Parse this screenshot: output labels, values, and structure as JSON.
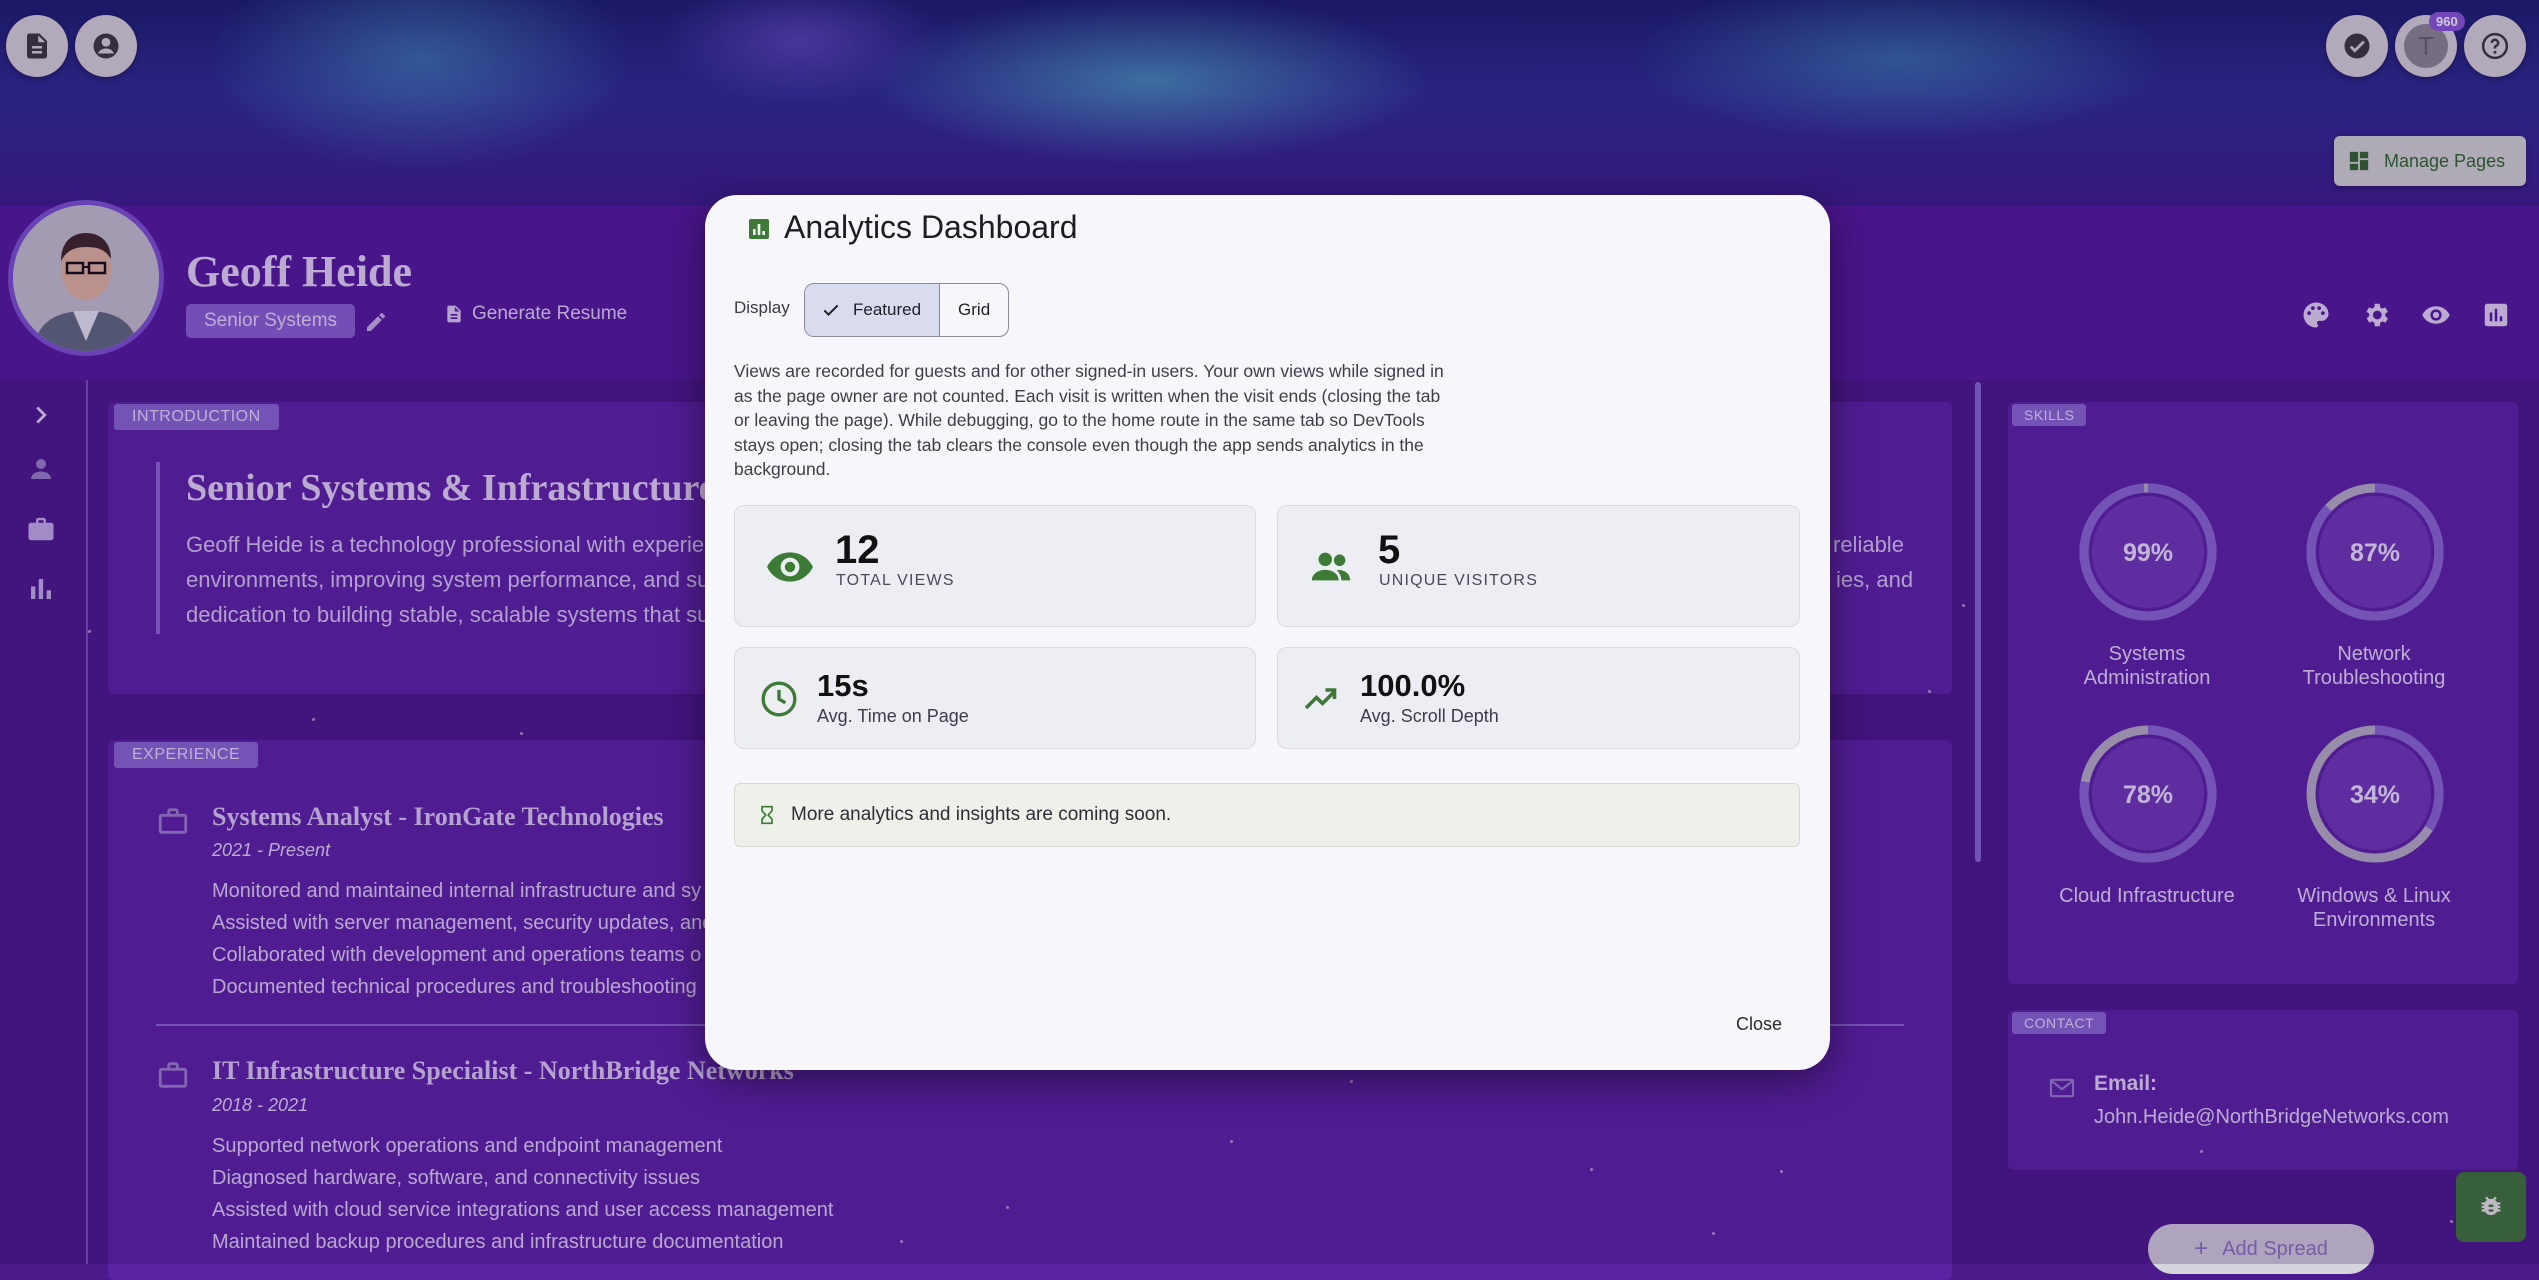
{
  "app": {
    "profile_name": "Geoff Heide",
    "role_chip": "Senior Systems",
    "generate_resume": "Generate Resume",
    "manage_pages": "Manage Pages",
    "notification_count": "960",
    "avatar_letter": "T"
  },
  "intro": {
    "tag": "INTRODUCTION",
    "title": "Senior Systems & Infrastructure",
    "line1": "Geoff Heide is a technology professional with experienc",
    "line2": "environments, improving system performance, and supp",
    "line3": "dedication to building stable, scalable systems that supp",
    "right1": "reliable",
    "right2": "ies, and"
  },
  "experience": {
    "tag": "EXPERIENCE",
    "jobs": [
      {
        "title": "Systems Analyst - IronGate Technologies",
        "date": "2021 - Present",
        "lines": [
          "Monitored and maintained internal infrastructure and sy",
          "Assisted with server management, security updates, and",
          "Collaborated with development and operations teams o",
          "Documented technical procedures and troubleshooting"
        ]
      },
      {
        "title": "IT Infrastructure Specialist - NorthBridge Networks",
        "date": "2018 - 2021",
        "lines": [
          "Supported network operations and endpoint management",
          "Diagnosed hardware, software, and connectivity issues",
          "Assisted with cloud service integrations and user access management",
          "Maintained backup procedures and infrastructure documentation"
        ]
      }
    ]
  },
  "skills": {
    "tag": "SKILLS",
    "items": [
      {
        "label_1": "Systems",
        "label_2": "Administration",
        "value_text": "99%",
        "value": 0.99
      },
      {
        "label_1": "Network",
        "label_2": "Troubleshooting",
        "value_text": "87%",
        "value": 0.87
      },
      {
        "label_1": "Cloud Infrastructure",
        "label_2": "",
        "value_text": "78%",
        "value": 0.78
      },
      {
        "label_1": "Windows & Linux",
        "label_2": "Environments",
        "value_text": "34%",
        "value": 0.34
      }
    ]
  },
  "contact": {
    "tag": "CONTACT",
    "email_label": "Email:",
    "email_value": "John.Heide@NorthBridgeNetworks.com"
  },
  "add_spread": "Add Spread",
  "dialog": {
    "title": "Analytics Dashboard",
    "display_label": "Display",
    "view_featured": "Featured",
    "view_grid": "Grid",
    "note": "Views are recorded for guests and for other signed-in users. Your own views while signed in as the page owner are not counted. Each visit is written when the visit ends (closing the tab or leaving the page). While debugging, go to the home route in the same tab so DevTools stays open; closing the tab clears the console even though the app sends analytics in the background.",
    "stats": {
      "total_views": {
        "value": "12",
        "label": "TOTAL VIEWS"
      },
      "unique_visitors": {
        "value": "5",
        "label": "UNIQUE VISITORS"
      },
      "avg_time": {
        "value": "15s",
        "label": "Avg. Time on Page"
      },
      "scroll_depth": {
        "value": "100.0%",
        "label": "Avg. Scroll Depth"
      }
    },
    "coming_soon": "More analytics and insights are coming soon.",
    "close": "Close"
  },
  "colors": {
    "accent_green": "#3d7a35",
    "purple_bg": "#4a1a8a",
    "gauge_ring": "#8a6bd4",
    "gauge_track": "#b8b4c4"
  }
}
